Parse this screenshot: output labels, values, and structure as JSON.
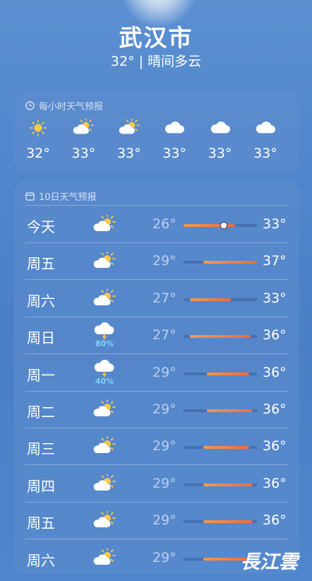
{
  "location": {
    "city": "武汉市",
    "summary": "32°  |  晴间多云"
  },
  "hourly": {
    "title": "每小时天气预报",
    "items": [
      {
        "icon": "sun-icon",
        "temp": "32°"
      },
      {
        "icon": "partly-cloudy-icon",
        "temp": "33°"
      },
      {
        "icon": "partly-cloudy-icon",
        "temp": "33°"
      },
      {
        "icon": "cloud-icon",
        "temp": "33°"
      },
      {
        "icon": "cloud-icon",
        "temp": "33°"
      },
      {
        "icon": "cloud-icon",
        "temp": "33°"
      }
    ]
  },
  "daily": {
    "title": "10日天气预报",
    "days": [
      {
        "name": "今天",
        "icon": "partly-cloudy-icon",
        "rain": "",
        "low": "26°",
        "high": "33°",
        "range_start": 0.0,
        "range_end": 0.7,
        "current": 0.55
      },
      {
        "name": "周五",
        "icon": "partly-cloudy-icon",
        "rain": "",
        "low": "29°",
        "high": "37°",
        "range_start": 0.27,
        "range_end": 1.0
      },
      {
        "name": "周六",
        "icon": "partly-cloudy-icon",
        "rain": "",
        "low": "27°",
        "high": "33°",
        "range_start": 0.09,
        "range_end": 0.64
      },
      {
        "name": "周日",
        "icon": "thunderstorm-icon",
        "rain": "80%",
        "low": "27°",
        "high": "36°",
        "range_start": 0.09,
        "range_end": 0.91
      },
      {
        "name": "周一",
        "icon": "thunderstorm-icon",
        "rain": "40%",
        "low": "29°",
        "high": "36°",
        "range_start": 0.32,
        "range_end": 0.89
      },
      {
        "name": "周二",
        "icon": "partly-cloudy-icon",
        "rain": "",
        "low": "29°",
        "high": "36°",
        "range_start": 0.32,
        "range_end": 0.94
      },
      {
        "name": "周三",
        "icon": "partly-cloudy-icon",
        "rain": "",
        "low": "29°",
        "high": "36°",
        "range_start": 0.27,
        "range_end": 0.89
      },
      {
        "name": "周四",
        "icon": "partly-cloudy-icon",
        "rain": "",
        "low": "29°",
        "high": "36°",
        "range_start": 0.27,
        "range_end": 0.94
      },
      {
        "name": "周五",
        "icon": "partly-cloudy-icon",
        "rain": "",
        "low": "29°",
        "high": "36°",
        "range_start": 0.27,
        "range_end": 0.94
      },
      {
        "name": "周六",
        "icon": "partly-cloudy-icon",
        "rain": "",
        "low": "29°",
        "high": "",
        "range_start": 0.27,
        "range_end": 0.9
      }
    ]
  },
  "watermark": "長江雲",
  "colors": {
    "sun": "#f7c948",
    "bar_warm": "#f39b4c",
    "bar_hot": "#ef6a3c",
    "rain_pct": "#7ed4ff"
  }
}
